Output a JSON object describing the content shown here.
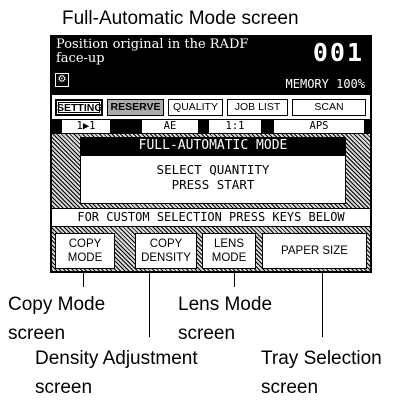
{
  "caption": "Full-Automatic Mode screen",
  "screen": {
    "instruction_line1": "Position original in the RADF",
    "instruction_line2": "face-up",
    "copy_count": "001",
    "memory": "MEMORY 100%",
    "tabs": [
      "SETTING",
      "RESERVE",
      "QUALITY",
      "JOB LIST",
      "SCAN"
    ],
    "status": [
      "1▶1",
      "AE",
      "1:1",
      "APS"
    ],
    "mode_title": "FULL-AUTOMATIC MODE",
    "message_line1": "SELECT QUANTITY",
    "message_line2": "PRESS START",
    "custom_prompt": "FOR CUSTOM SELECTION PRESS KEYS BELOW",
    "keys": [
      {
        "line1": "COPY",
        "line2": "MODE"
      },
      {
        "line1": "COPY",
        "line2": "DENSITY"
      },
      {
        "line1": "LENS",
        "line2": "MODE"
      },
      {
        "line1": "PAPER SIZE",
        "line2": ""
      }
    ]
  },
  "callouts": {
    "copy_mode_1": "Copy Mode",
    "copy_mode_2": "screen",
    "lens_mode_1": "Lens Mode",
    "lens_mode_2": "screen",
    "density_1": "Density Adjustment",
    "density_2": "screen",
    "tray_1": "Tray Selection",
    "tray_2": "screen"
  }
}
